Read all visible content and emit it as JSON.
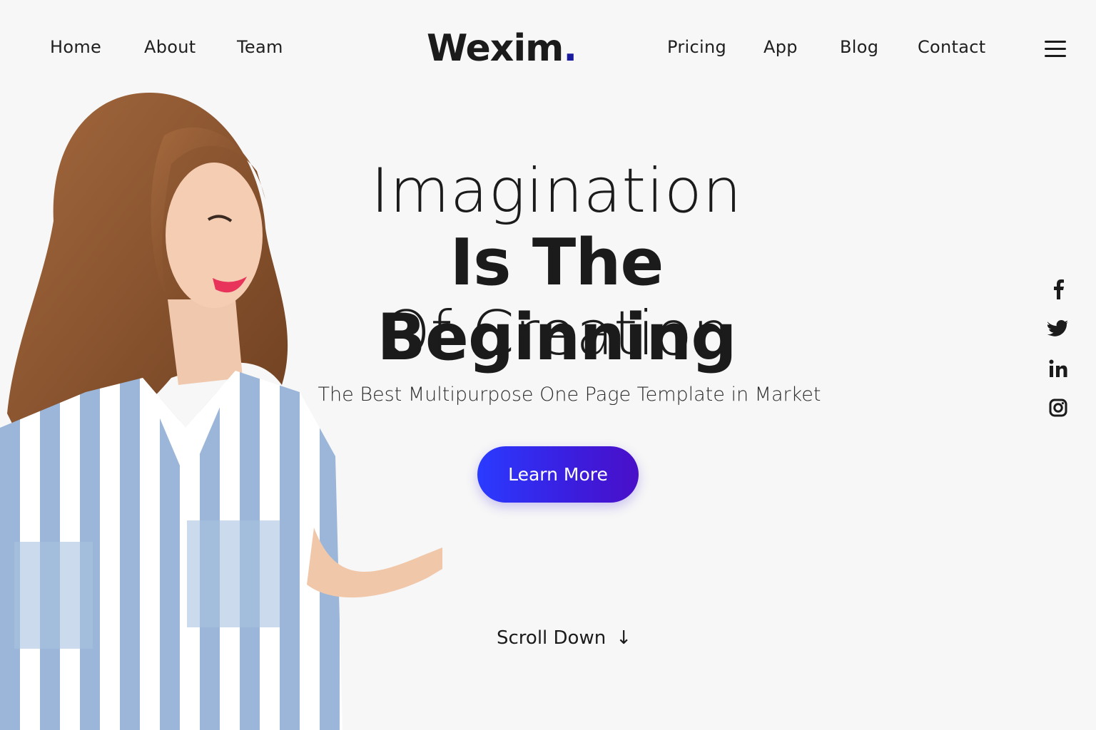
{
  "nav": {
    "left": [
      "Home",
      "About",
      "Team"
    ],
    "right": [
      "Pricing",
      "App",
      "Blog",
      "Contact"
    ]
  },
  "logo": {
    "text": "Wexim",
    "dot": "."
  },
  "hero": {
    "line1": "Imagination",
    "line2": "Is The Beginning",
    "line3": "Of Creation",
    "tagline": "The Best Multipurpose One Page Template in Market",
    "cta_label": "Learn More",
    "scroll_label": "Scroll Down",
    "scroll_arrow": "↓"
  },
  "social": [
    "facebook-icon",
    "twitter-icon",
    "linkedin-icon",
    "instagram-icon"
  ],
  "colors": {
    "background": "#f7f7f7",
    "text": "#1b1b1b",
    "cta_gradient_start": "#2a3bff",
    "cta_gradient_end": "#4a0fc8"
  }
}
